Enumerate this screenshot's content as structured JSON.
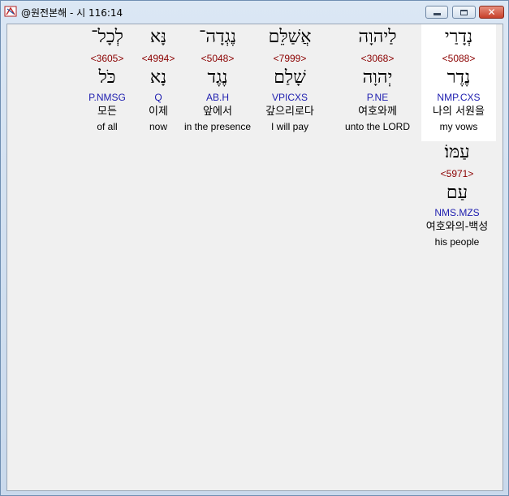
{
  "window": {
    "title": "@원전본해 - 시 116:14",
    "icons": {
      "app": "bible-app-icon",
      "minimize": "minimize-icon",
      "maximize": "maximize-icon",
      "close": "close-icon"
    }
  },
  "words": [
    {
      "word": "נְדָרַי",
      "strong": "<5088>",
      "lemma": "נֶדֶר",
      "morph": "NMP.CXS",
      "korean": "나의 서원을",
      "english": "my vows",
      "selected": true
    },
    {
      "word": "לַיהוָה",
      "strong": "<3068>",
      "lemma": "יְהוָה",
      "morph": "P.NE",
      "korean": "여호와께",
      "english": "unto the LORD",
      "selected": false
    },
    {
      "word": "אֲשַׁלֵּם",
      "strong": "<7999>",
      "lemma": "שָׁלַם",
      "morph": "VPICXS",
      "korean": "갚으리로다",
      "english": "I will pay",
      "selected": false
    },
    {
      "word": "נֶגְדָה־",
      "strong": "<5048>",
      "lemma": "נֶגֶד",
      "morph": "AB.H",
      "korean": "앞에서",
      "english": "in the presence",
      "selected": false
    },
    {
      "word": "נָּא",
      "strong": "<4994>",
      "lemma": "נָא",
      "morph": "Q",
      "korean": "이제",
      "english": "now",
      "selected": false
    },
    {
      "word": "לְכָל־",
      "strong": "<3605>",
      "lemma": "כֹּל",
      "morph": "P.NMSG",
      "korean": "모든",
      "english": "of all",
      "selected": false
    },
    {
      "word": "עַמּוֹ׃",
      "strong": "<5971>",
      "lemma": "עַם",
      "morph": "NMS.MZS",
      "korean": "여호와의-백성",
      "english": "his people",
      "selected": false
    }
  ]
}
